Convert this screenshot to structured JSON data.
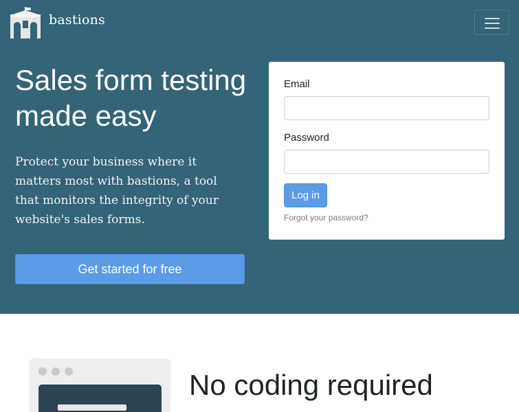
{
  "header": {
    "brand": "bastions",
    "logo_icon": "bastion-building-icon",
    "menu_icon": "hamburger-icon"
  },
  "hero": {
    "title_line1": "Sales form testing",
    "title_line2": "made easy",
    "description": "Protect your business where it matters most with bastions, a tool that monitors the integrity of your website's sales forms.",
    "cta_label": "Get started for free"
  },
  "login": {
    "email_label": "Email",
    "email_value": "",
    "password_label": "Password",
    "password_value": "",
    "submit_label": "Log in",
    "forgot_label": "Forgot your password?"
  },
  "features": {
    "title": "No coding required",
    "illustration_icon": "browser-window-icon"
  },
  "colors": {
    "hero_background": "#336477",
    "accent": "#5b9be8",
    "card_background": "#ffffff"
  }
}
